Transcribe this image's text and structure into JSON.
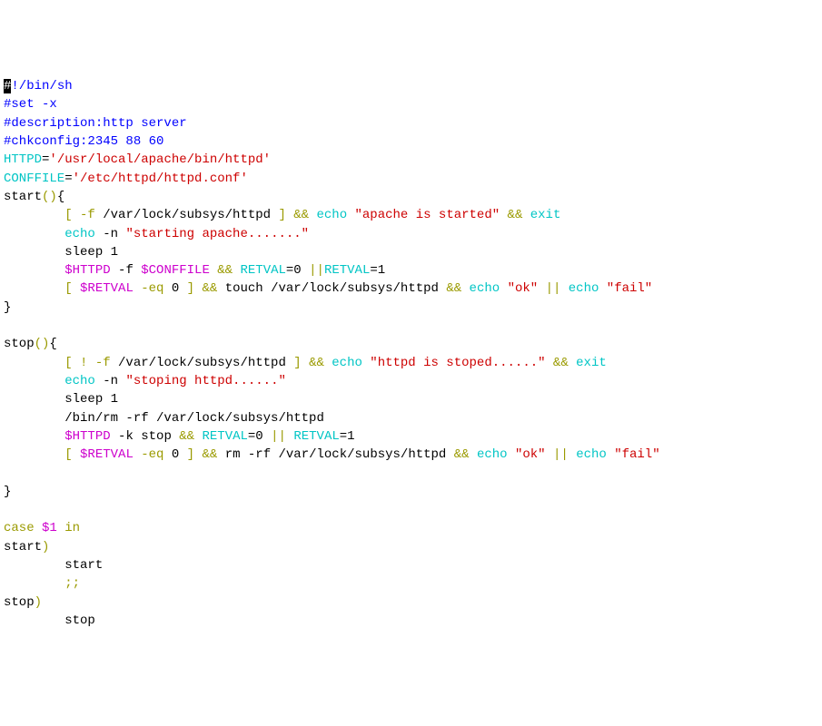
{
  "lines": [
    [
      {
        "cls": "cursor",
        "t": "#"
      },
      {
        "cls": "comment",
        "t": "!/bin/sh"
      }
    ],
    [
      {
        "cls": "comment",
        "t": "#set -x"
      }
    ],
    [
      {
        "cls": "comment",
        "t": "#description:http server"
      }
    ],
    [
      {
        "cls": "comment",
        "t": "#chkconfig:2345 88 60"
      }
    ],
    [
      {
        "cls": "cyan",
        "t": "HTTPD"
      },
      {
        "cls": "black",
        "t": "="
      },
      {
        "cls": "red",
        "t": "'/usr/local/apache/bin/httpd'"
      }
    ],
    [
      {
        "cls": "cyan",
        "t": "CONFFILE"
      },
      {
        "cls": "black",
        "t": "="
      },
      {
        "cls": "red",
        "t": "'/etc/httpd/httpd.conf'"
      }
    ],
    [
      {
        "cls": "black",
        "t": "start"
      },
      {
        "cls": "olive",
        "t": "()"
      },
      {
        "cls": "black",
        "t": "{"
      }
    ],
    [
      {
        "cls": "black",
        "t": "        "
      },
      {
        "cls": "olive",
        "t": "[ -f "
      },
      {
        "cls": "black",
        "t": "/var/lock/subsys/httpd "
      },
      {
        "cls": "olive",
        "t": "] && "
      },
      {
        "cls": "cyan",
        "t": "echo "
      },
      {
        "cls": "red",
        "t": "\"apache is started\""
      },
      {
        "cls": "olive",
        "t": " && "
      },
      {
        "cls": "cyan",
        "t": "exit"
      }
    ],
    [
      {
        "cls": "black",
        "t": "        "
      },
      {
        "cls": "cyan",
        "t": "echo"
      },
      {
        "cls": "black",
        "t": " -n "
      },
      {
        "cls": "red",
        "t": "\"starting apache.......\""
      }
    ],
    [
      {
        "cls": "black",
        "t": "        sleep 1"
      }
    ],
    [
      {
        "cls": "black",
        "t": "        "
      },
      {
        "cls": "magenta",
        "t": "$HTTPD"
      },
      {
        "cls": "black",
        "t": " -f "
      },
      {
        "cls": "magenta",
        "t": "$CONFFILE"
      },
      {
        "cls": "olive",
        "t": " && "
      },
      {
        "cls": "cyan",
        "t": "RETVAL"
      },
      {
        "cls": "black",
        "t": "=0 "
      },
      {
        "cls": "olive",
        "t": "||"
      },
      {
        "cls": "cyan",
        "t": "RETVAL"
      },
      {
        "cls": "black",
        "t": "=1"
      }
    ],
    [
      {
        "cls": "black",
        "t": "        "
      },
      {
        "cls": "olive",
        "t": "[ "
      },
      {
        "cls": "magenta",
        "t": "$RETVAL"
      },
      {
        "cls": "olive",
        "t": " -eq "
      },
      {
        "cls": "black",
        "t": "0 "
      },
      {
        "cls": "olive",
        "t": "] && "
      },
      {
        "cls": "black",
        "t": "touch /var/lock/subsys/httpd "
      },
      {
        "cls": "olive",
        "t": "&& "
      },
      {
        "cls": "cyan",
        "t": "echo "
      },
      {
        "cls": "red",
        "t": "\"ok\""
      },
      {
        "cls": "olive",
        "t": " || "
      },
      {
        "cls": "cyan",
        "t": "echo "
      },
      {
        "cls": "red",
        "t": "\"fail\""
      }
    ],
    [
      {
        "cls": "black",
        "t": "}"
      }
    ],
    [
      {
        "cls": "black",
        "t": ""
      }
    ],
    [
      {
        "cls": "black",
        "t": "stop"
      },
      {
        "cls": "olive",
        "t": "()"
      },
      {
        "cls": "black",
        "t": "{"
      }
    ],
    [
      {
        "cls": "black",
        "t": "        "
      },
      {
        "cls": "olive",
        "t": "[ ! -f "
      },
      {
        "cls": "black",
        "t": "/var/lock/subsys/httpd "
      },
      {
        "cls": "olive",
        "t": "] && "
      },
      {
        "cls": "cyan",
        "t": "echo "
      },
      {
        "cls": "red",
        "t": "\"httpd is stoped......\""
      },
      {
        "cls": "olive",
        "t": " && "
      },
      {
        "cls": "cyan",
        "t": "exit"
      }
    ],
    [
      {
        "cls": "black",
        "t": "        "
      },
      {
        "cls": "cyan",
        "t": "echo"
      },
      {
        "cls": "black",
        "t": " -n "
      },
      {
        "cls": "red",
        "t": "\"stoping httpd......\""
      }
    ],
    [
      {
        "cls": "black",
        "t": "        sleep 1"
      }
    ],
    [
      {
        "cls": "black",
        "t": "        /bin/rm -rf /var/lock/subsys/httpd"
      }
    ],
    [
      {
        "cls": "black",
        "t": "        "
      },
      {
        "cls": "magenta",
        "t": "$HTTPD"
      },
      {
        "cls": "black",
        "t": " -k stop "
      },
      {
        "cls": "olive",
        "t": "&& "
      },
      {
        "cls": "cyan",
        "t": "RETVAL"
      },
      {
        "cls": "black",
        "t": "=0 "
      },
      {
        "cls": "olive",
        "t": "|| "
      },
      {
        "cls": "cyan",
        "t": "RETVAL"
      },
      {
        "cls": "black",
        "t": "=1"
      }
    ],
    [
      {
        "cls": "black",
        "t": "        "
      },
      {
        "cls": "olive",
        "t": "[ "
      },
      {
        "cls": "magenta",
        "t": "$RETVAL"
      },
      {
        "cls": "olive",
        "t": " -eq "
      },
      {
        "cls": "black",
        "t": "0 "
      },
      {
        "cls": "olive",
        "t": "] && "
      },
      {
        "cls": "black",
        "t": "rm -rf /var/lock/subsys/httpd "
      },
      {
        "cls": "olive",
        "t": "&& "
      },
      {
        "cls": "cyan",
        "t": "echo "
      },
      {
        "cls": "red",
        "t": "\"ok\""
      },
      {
        "cls": "olive",
        "t": " || "
      },
      {
        "cls": "cyan",
        "t": "echo "
      },
      {
        "cls": "red",
        "t": "\"fail\""
      }
    ],
    [
      {
        "cls": "black",
        "t": ""
      }
    ],
    [
      {
        "cls": "black",
        "t": "}"
      }
    ],
    [
      {
        "cls": "black",
        "t": ""
      }
    ],
    [
      {
        "cls": "olive",
        "t": "case "
      },
      {
        "cls": "magenta",
        "t": "$1"
      },
      {
        "cls": "olive",
        "t": " in"
      }
    ],
    [
      {
        "cls": "black",
        "t": "start"
      },
      {
        "cls": "olive",
        "t": ")"
      }
    ],
    [
      {
        "cls": "black",
        "t": "        start"
      }
    ],
    [
      {
        "cls": "black",
        "t": "        "
      },
      {
        "cls": "olive",
        "t": ";;"
      }
    ],
    [
      {
        "cls": "black",
        "t": "stop"
      },
      {
        "cls": "olive",
        "t": ")"
      }
    ],
    [
      {
        "cls": "black",
        "t": "        stop"
      }
    ]
  ]
}
